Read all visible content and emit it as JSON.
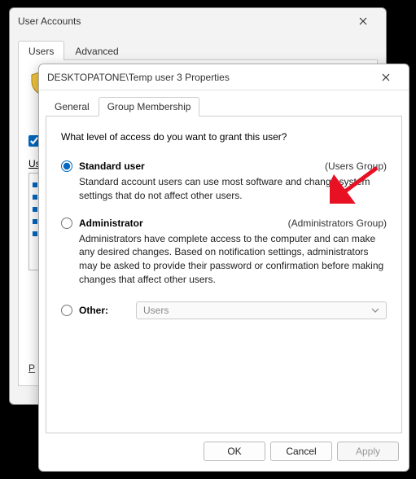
{
  "parent": {
    "title": "User Accounts",
    "tabs": {
      "users": "Users",
      "advanced": "Advanced"
    },
    "users_label": "Us",
    "bottom_label": "P"
  },
  "child": {
    "title": "DESKTOPATONE\\Temp user 3 Properties",
    "tabs": {
      "general": "General",
      "group": "Group Membership"
    },
    "prompt": "What level of access do you want to grant this user?",
    "options": {
      "standard": {
        "label": "Standard user",
        "group": "(Users Group)",
        "desc": "Standard account users can use most software and change system settings that do not affect other users."
      },
      "admin": {
        "label": "Administrator",
        "group": "(Administrators Group)",
        "desc": "Administrators have complete access to the computer and can make any desired changes. Based on notification settings, administrators may be asked to provide their password or confirmation before making changes that affect other users."
      },
      "other": {
        "label": "Other:",
        "selected": "Users"
      }
    },
    "buttons": {
      "ok": "OK",
      "cancel": "Cancel",
      "apply": "Apply"
    }
  }
}
